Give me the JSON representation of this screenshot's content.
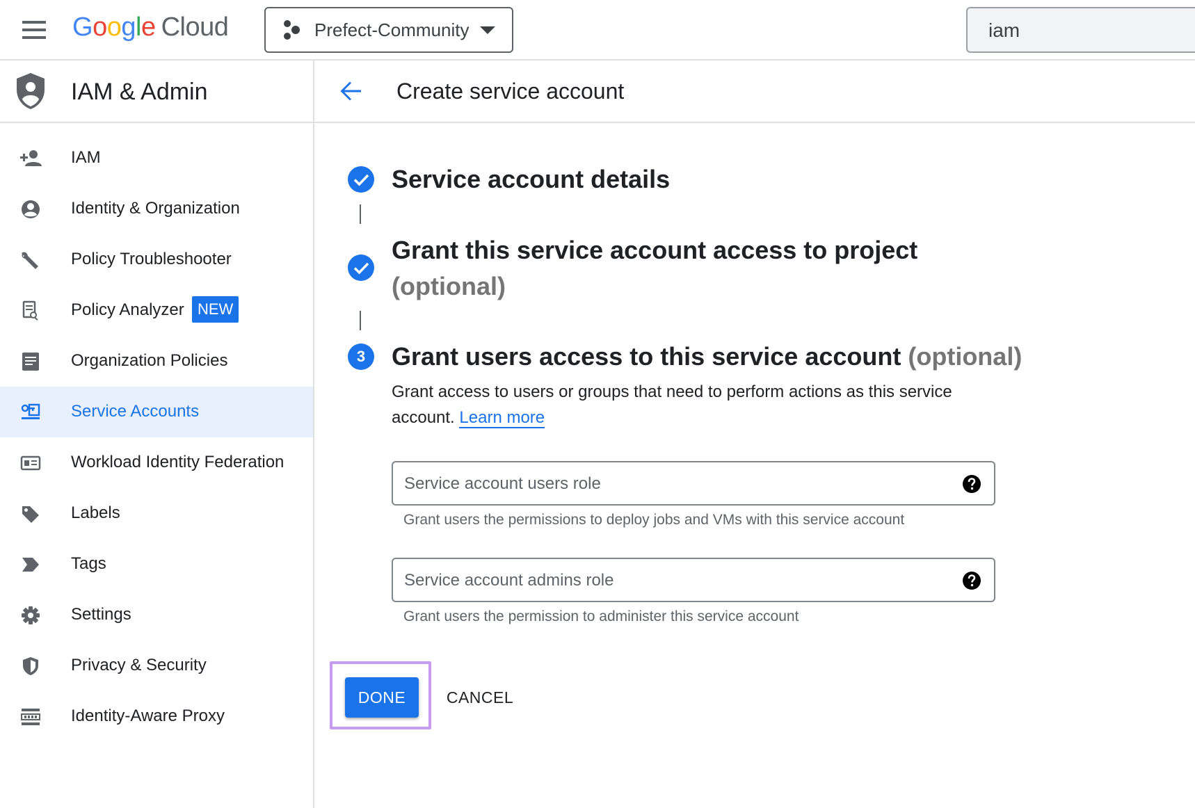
{
  "topbar": {
    "logo_letters": [
      "G",
      "o",
      "o",
      "g",
      "l",
      "e"
    ],
    "logo_product": "Cloud",
    "project_name": "Prefect-Community",
    "search_value": "iam"
  },
  "sidebar": {
    "title": "IAM & Admin",
    "items": [
      {
        "label": "IAM",
        "icon": "person-add-icon"
      },
      {
        "label": "Identity & Organization",
        "icon": "account-circle-icon"
      },
      {
        "label": "Policy Troubleshooter",
        "icon": "wrench-icon"
      },
      {
        "label": "Policy Analyzer",
        "icon": "document-search-icon",
        "badge": "NEW"
      },
      {
        "label": "Organization Policies",
        "icon": "list-document-icon"
      },
      {
        "label": "Service Accounts",
        "icon": "service-account-icon",
        "active": true
      },
      {
        "label": "Workload Identity Federation",
        "icon": "id-card-icon"
      },
      {
        "label": "Labels",
        "icon": "label-tag-icon"
      },
      {
        "label": "Tags",
        "icon": "tag-arrow-icon"
      },
      {
        "label": "Settings",
        "icon": "gear-icon"
      },
      {
        "label": "Privacy & Security",
        "icon": "shield-icon"
      },
      {
        "label": "Identity-Aware Proxy",
        "icon": "proxy-icon"
      }
    ]
  },
  "main": {
    "page_title": "Create service account",
    "steps": [
      {
        "title": "Service account details",
        "status": "complete"
      },
      {
        "title": "Grant this service account access to project",
        "optional": "(optional)",
        "status": "complete"
      },
      {
        "number": "3",
        "title": "Grant users access to this service account",
        "optional": "(optional)",
        "status": "current"
      }
    ],
    "step3_description": "Grant access to users or groups that need to perform actions as this service account.",
    "learn_more": "Learn more",
    "fields": [
      {
        "label": "Service account users role",
        "hint": "Grant users the permissions to deploy jobs and VMs with this service account"
      },
      {
        "label": "Service account admins role",
        "hint": "Grant users the permission to administer this service account"
      }
    ],
    "done_label": "DONE",
    "cancel_label": "CANCEL"
  },
  "colors": {
    "accent": "#1a73e8",
    "active_bg": "#e8f0fe",
    "highlight_outline": "#c79cf0"
  }
}
